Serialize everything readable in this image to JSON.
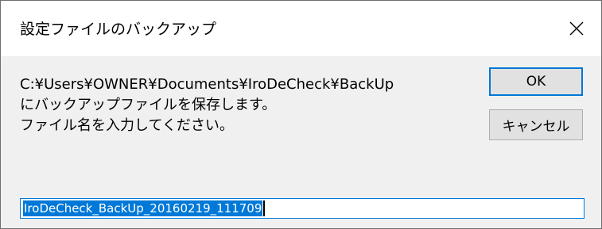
{
  "dialog": {
    "title": "設定ファイルのバックアップ",
    "message_lines": [
      "C:¥Users¥OWNER¥Documents¥IroDeCheck¥BackUp",
      "にバックアップファイルを保存します。",
      "ファイル名を入力してください。"
    ],
    "ok_label": "OK",
    "cancel_label": "キャンセル",
    "filename_value": "IroDeCheck_BackUp_20160219_111709",
    "close_icon": "close-icon"
  },
  "colors": {
    "accent": "#0078d7",
    "title_bar": "#ffffff",
    "body": "#f0f0f0",
    "button_face": "#e1e1e1",
    "button_border": "#adadad"
  }
}
